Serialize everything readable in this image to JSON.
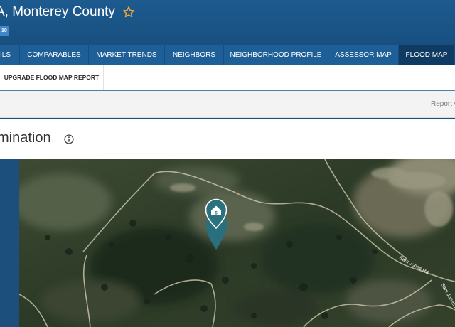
{
  "header": {
    "title": "A, Monterey County",
    "badge": "10"
  },
  "tabs": [
    {
      "label": "ILS",
      "active": false
    },
    {
      "label": "COMPARABLES",
      "active": false
    },
    {
      "label": "MARKET TRENDS",
      "active": false
    },
    {
      "label": "NEIGHBORS",
      "active": false
    },
    {
      "label": "NEIGHBORHOOD PROFILE",
      "active": false
    },
    {
      "label": "ASSESSOR MAP",
      "active": false
    },
    {
      "label": "FLOOD MAP",
      "active": true
    }
  ],
  "subnav": {
    "upgrade_label": "UPGRADE FLOOD MAP REPORT"
  },
  "report_link": "Report C",
  "section": {
    "title": "mination"
  },
  "map": {
    "road_labels": [
      "Sam Jones Rd",
      "Sam Jones Rd"
    ],
    "marker_icon": "home-icon"
  },
  "colors": {
    "header": "#1d5a8f",
    "tab": "#1f5f98",
    "tab_active": "#0f3a62",
    "marker": "#2a6f7d",
    "star": "#f1a83b"
  }
}
